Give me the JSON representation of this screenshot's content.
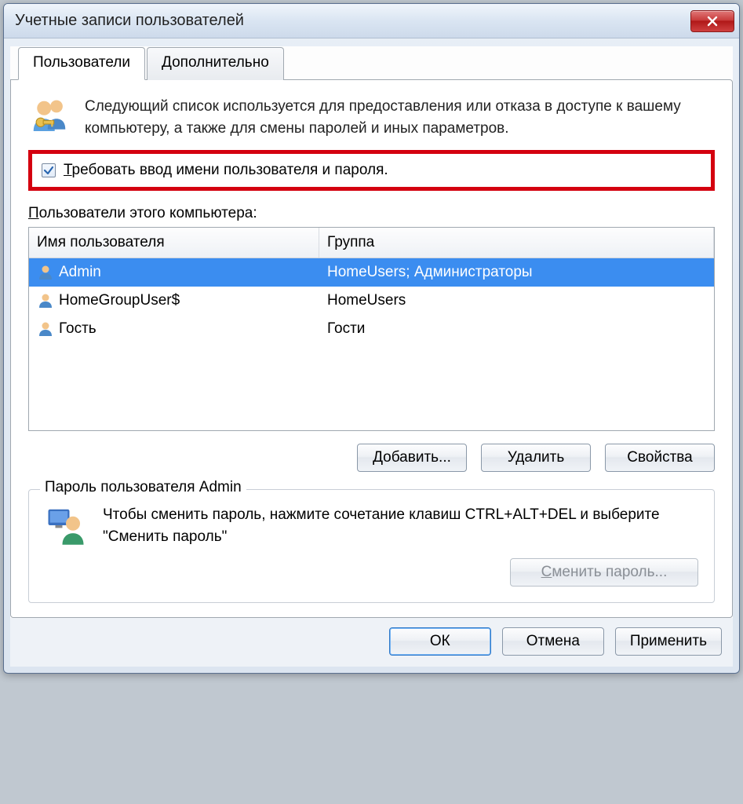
{
  "window": {
    "title": "Учетные записи пользователей"
  },
  "tabs": {
    "users": "Пользователи",
    "advanced": "Дополнительно"
  },
  "intro": "Следующий список используется для предоставления или отказа в доступе к вашему компьютеру, а также для смены паролей и иных параметров.",
  "checkbox": {
    "label": "Требовать ввод имени пользователя и пароля."
  },
  "list": {
    "label": "Пользователи этого компьютера:",
    "columns": {
      "name": "Имя пользователя",
      "group": "Группа"
    },
    "rows": [
      {
        "name": "Admin",
        "group": "HomeUsers; Администраторы",
        "selected": true
      },
      {
        "name": "HomeGroupUser$",
        "group": "HomeUsers",
        "selected": false
      },
      {
        "name": "Гость",
        "group": "Гости",
        "selected": false
      }
    ]
  },
  "buttons": {
    "add": "Добавить...",
    "remove": "Удалить",
    "properties": "Свойства"
  },
  "passwordBox": {
    "legend": "Пароль пользователя Admin",
    "text": "Чтобы сменить пароль, нажмите сочетание клавиш CTRL+ALT+DEL и выберите \"Сменить пароль\"",
    "button": "Сменить пароль..."
  },
  "footer": {
    "ok": "ОК",
    "cancel": "Отмена",
    "apply": "Применить"
  }
}
